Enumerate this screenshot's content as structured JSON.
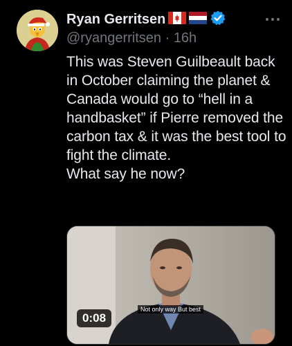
{
  "tweet": {
    "display_name": "Ryan Gerritsen",
    "handle": "@ryangerritsen",
    "separator": " · ",
    "time": "16h",
    "flags": [
      "canada-flag",
      "netherlands-flag"
    ],
    "verified_icon": "verified-badge-icon",
    "more_icon": "more-options-icon",
    "text": "This was Steven Guilbeault back in October claiming the planet & Canada would go to “hell in a handbasket” if Pierre removed the carbon tax & it was the best tool to fight the climate.\nWhat say he now?"
  },
  "media": {
    "duration": "0:08",
    "subtitle": "Not only way But best"
  },
  "colors": {
    "background": "#000000",
    "text": "#e7e9ea",
    "secondary": "#71767b",
    "verified": "#1d9bf0",
    "canada_red": "#d52b1e",
    "nl_red": "#ae1c28",
    "nl_blue": "#21468b"
  }
}
